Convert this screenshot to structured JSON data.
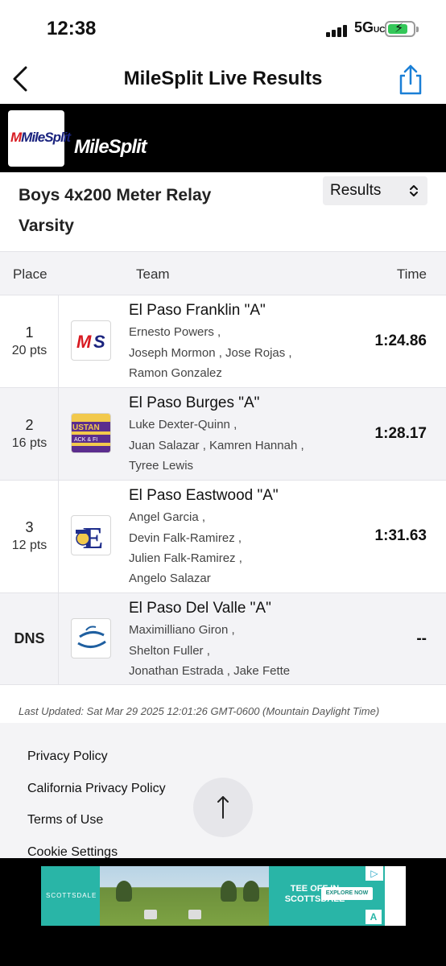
{
  "status_bar": {
    "time": "12:38",
    "network": "5G",
    "network_suffix": "UC"
  },
  "nav": {
    "title": "MileSplit Live Results"
  },
  "banner": {
    "logo_text": "MileSplit",
    "wordmark": "MileSplit"
  },
  "event": {
    "name_line1": "Boys 4x200 Meter Relay",
    "name_line2": "Varsity",
    "view_select": "Results"
  },
  "table": {
    "headers": {
      "place": "Place",
      "team": "Team",
      "time": "Time"
    },
    "rows": [
      {
        "place": "1",
        "points": "20 pts",
        "team": "El Paso Franklin \"A\"",
        "athletes": [
          "Ernesto Powers ,",
          "Joseph Mormon ,  Jose Rojas ,",
          "Ramon Gonzalez"
        ],
        "time": "1:24.86",
        "logo_text": "MS",
        "logo_color": "#d81b22"
      },
      {
        "place": "2",
        "points": "16 pts",
        "team": "El Paso Burges \"A\"",
        "athletes": [
          "Luke Dexter-Quinn ,",
          "Juan Salazar ,  Kamren Hannah ,",
          "Tyree Lewis"
        ],
        "time": "1:28.17",
        "logo_text": "USTAN",
        "logo_color": "#5b2d8e"
      },
      {
        "place": "3",
        "points": "12 pts",
        "team": "El Paso Eastwood \"A\"",
        "athletes": [
          "Angel Garcia ,",
          "Devin Falk-Ramirez ,",
          "Julien Falk-Ramirez ,",
          "Angelo Salazar"
        ],
        "time": "1:31.63",
        "logo_text": "E",
        "logo_color": "#1f2e8c"
      },
      {
        "place": "DNS",
        "points": "",
        "team": "El Paso Del Valle \"A\"",
        "athletes": [
          "Maximilliano Giron ,",
          "Shelton Fuller ,",
          "Jonathan Estrada ,  Jake Fette"
        ],
        "time": "--",
        "logo_text": "",
        "logo_color": "#1f5fa0"
      }
    ]
  },
  "last_updated": "Last Updated: Sat Mar 29 2025 12:01:26 GMT-0600 (Mountain Daylight Time)",
  "footer": {
    "links": [
      "Privacy Policy",
      "California Privacy Policy",
      "Terms of Use",
      "Cookie Settings"
    ]
  },
  "ad": {
    "brand": "SCOTTSDALE",
    "headline_line1": "TEE OFF IN",
    "headline_line2": "SCOTTSDALE",
    "cta": "EXPLORE NOW"
  },
  "colors": {
    "banner_bg": "#000000",
    "accent_blue": "#1a7fd6",
    "battery_green": "#34c759",
    "ad_teal": "#29b5a7"
  }
}
